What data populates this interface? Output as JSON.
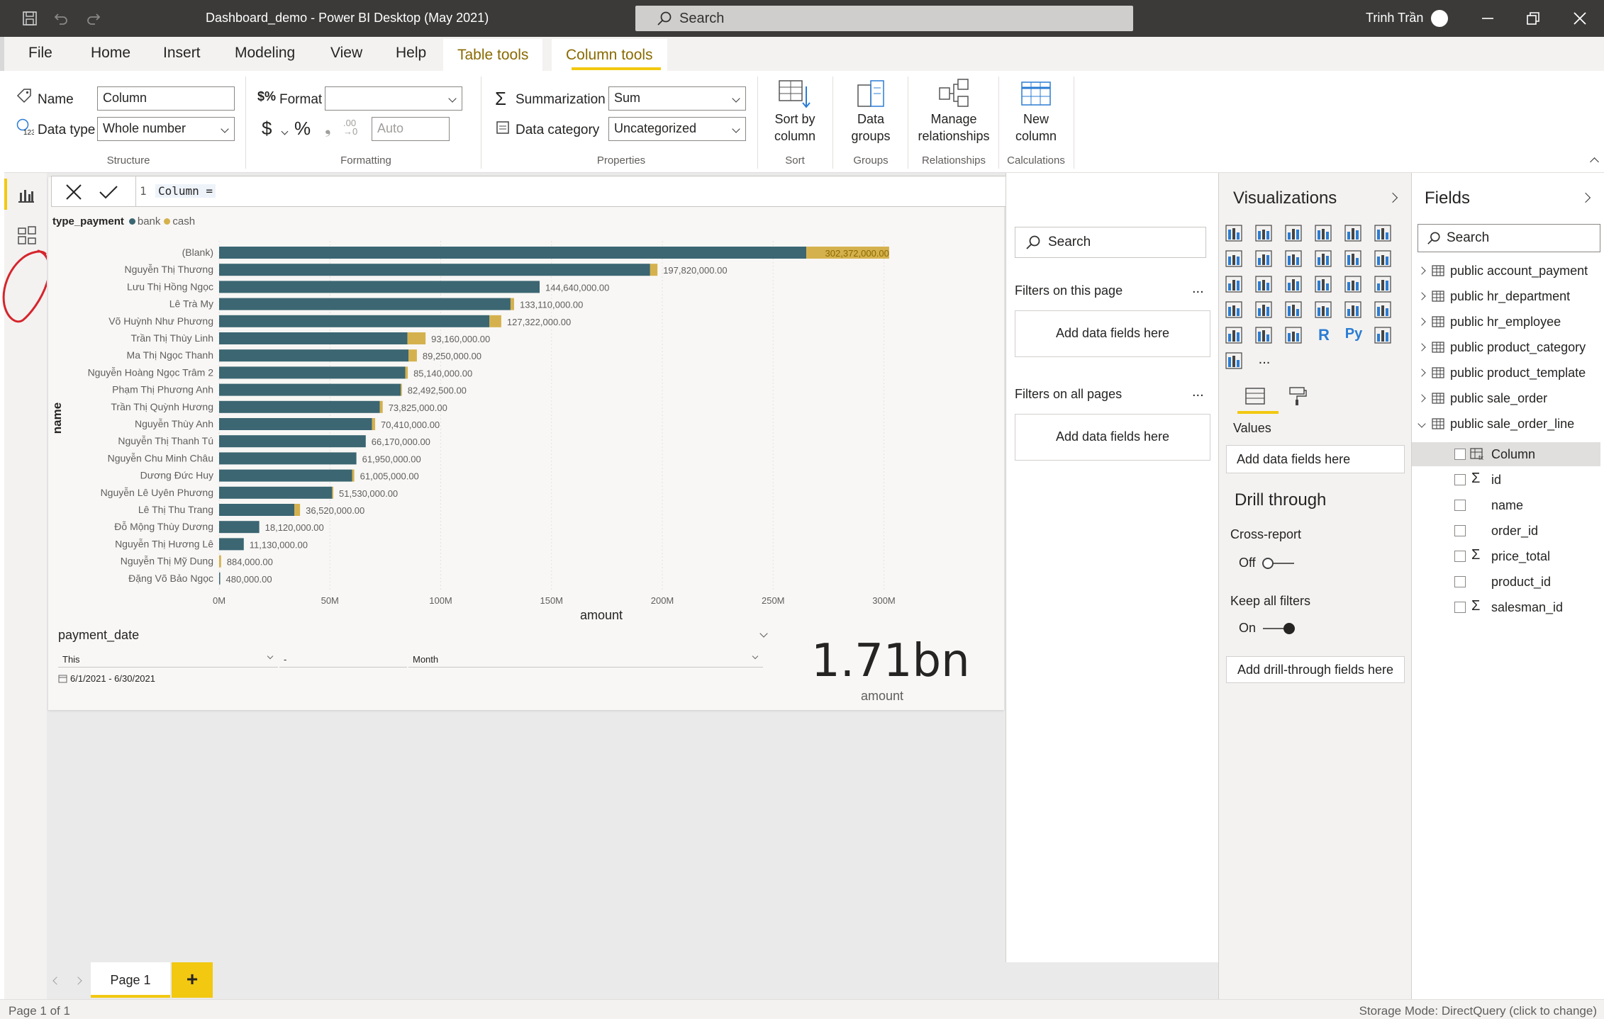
{
  "titlebar": {
    "document_title": "Dashboard_demo - Power BI Desktop (May 2021)",
    "search_placeholder": "Search",
    "user_name": "Trinh Trần"
  },
  "menu_tabs": [
    "File",
    "Home",
    "Insert",
    "Modeling",
    "View",
    "Help"
  ],
  "context_tabs": {
    "table_tools": "Table tools",
    "column_tools": "Column tools"
  },
  "ribbon": {
    "structure": {
      "name_label": "Name",
      "name_value": "Column",
      "datatype_label": "Data type",
      "datatype_value": "Whole number",
      "group": "Structure"
    },
    "formatting": {
      "format_label": "Format",
      "format_value": "",
      "currency": "$",
      "percent": "%",
      "comma": "❟",
      "decimals": "Auto",
      "group": "Formatting"
    },
    "properties": {
      "summarization_label": "Summarization",
      "summarization_value": "Sum",
      "category_label": "Data category",
      "category_value": "Uncategorized",
      "group": "Properties"
    },
    "sort": {
      "button": "Sort by column",
      "line1": "Sort by",
      "line2": "column",
      "group": "Sort"
    },
    "groups": {
      "line1": "Data",
      "line2": "groups",
      "group": "Groups"
    },
    "relationships": {
      "line1": "Manage",
      "line2": "relationships",
      "group": "Relationships"
    },
    "calculations": {
      "line1": "New",
      "line2": "column",
      "group": "Calculations"
    }
  },
  "formula": {
    "line_number": "1",
    "expression": "Column ="
  },
  "chart_data": {
    "type": "bar",
    "stacked": true,
    "orientation": "horizontal",
    "legend_title": "type_payment",
    "legend": [
      "bank",
      "cash"
    ],
    "ylabel": "name",
    "xlabel": "amount",
    "xlim": [
      0,
      320000000
    ],
    "xticks": [
      "0M",
      "50M",
      "100M",
      "150M",
      "200M",
      "250M",
      "300M"
    ],
    "grid": true,
    "categories": [
      "(Blank)",
      "Nguyễn Thị Thương",
      "Lưu Thị Hồng Ngọc",
      "Lê Trà My",
      "Võ Huỳnh Như Phương",
      "Trần Thị Thùy Linh",
      "Ma Thị Ngọc Thanh",
      "Nguyễn Hoàng Ngọc Trâm 2",
      "Phạm Thị Phương Anh",
      "Trần Thị Quỳnh Hương",
      "Nguyễn Thùy Anh",
      "Nguyễn Thị Thanh Tú",
      "Nguyễn Chu Minh Châu",
      "Dương Đức Huy",
      "Nguyễn Lê Uyên Phương",
      "Lê Thị Thu Trang",
      "Đỗ Mộng Thùy Dương",
      "Nguyễn Thị Hương Lê",
      "Nguyễn Thị Mỹ Dung",
      "Đặng Võ Bảo Ngọc"
    ],
    "series": [
      {
        "name": "bank",
        "values": [
          265000000,
          194500000,
          144640000,
          131500000,
          122000000,
          85000000,
          85500000,
          84000000,
          82000000,
          72500000,
          69000000,
          66170000,
          61950000,
          60000000,
          51000000,
          34000000,
          18120000,
          11130000,
          0,
          480000
        ]
      },
      {
        "name": "cash",
        "values": [
          37372000,
          3320000,
          0,
          1610000,
          5322000,
          8160000,
          3750000,
          1140000,
          492500,
          1325000,
          1410000,
          0,
          0,
          1005000,
          530000,
          2520000,
          0,
          0,
          884000,
          0
        ]
      }
    ],
    "total_labels": [
      "302,372,000.00",
      "197,820,000.00",
      "144,640,000.00",
      "133,110,000.00",
      "127,322,000.00",
      "93,160,000.00",
      "89,250,000.00",
      "85,140,000.00",
      "82,492,500.00",
      "73,825,000.00",
      "70,410,000.00",
      "66,170,000.00",
      "61,950,000.00",
      "61,005,000.00",
      "51,530,000.00",
      "36,520,000.00",
      "18,120,000.00",
      "11,130,000.00",
      "884,000.00",
      "480,000.00"
    ],
    "colors": {
      "bank": "#3b6672",
      "cash": "#d5b14d"
    }
  },
  "slicer": {
    "title": "payment_date",
    "relative": "This",
    "count": "-",
    "period": "Month",
    "range": "6/1/2021 - 6/30/2021"
  },
  "card": {
    "value": "1.71bn",
    "label": "amount"
  },
  "filters": {
    "search_placeholder": "Search",
    "this_page_label": "Filters on this page",
    "all_pages_label": "Filters on all pages",
    "dropzone_label": "Add data fields here",
    "more": "..."
  },
  "visualizations": {
    "title": "Visualizations",
    "values_label": "Values",
    "values_dropzone": "Add data fields here",
    "drill_title": "Drill through",
    "cross_report_label": "Cross-report",
    "cross_report_state": "Off",
    "keep_filters_label": "Keep all filters",
    "keep_filters_state": "On",
    "drill_dropzone": "Add drill-through fields here",
    "more": "...",
    "r_icon": "R",
    "py_icon": "Py"
  },
  "fields": {
    "title": "Fields",
    "search_placeholder": "Search",
    "tables": [
      "public account_payment",
      "public hr_department",
      "public hr_employee",
      "public product_category",
      "public product_template",
      "public sale_order",
      "public sale_order_line"
    ],
    "expanded_columns": [
      "Column",
      "id",
      "name",
      "order_id",
      "price_total",
      "product_id",
      "salesman_id"
    ]
  },
  "pages": {
    "tab": "Page 1",
    "add": "+"
  },
  "status": {
    "page_info": "Page 1 of 1",
    "storage_mode": "Storage Mode: DirectQuery (click to change)"
  },
  "colors": {
    "accent": "#f2c811",
    "titlebar": "#3b3a39"
  }
}
